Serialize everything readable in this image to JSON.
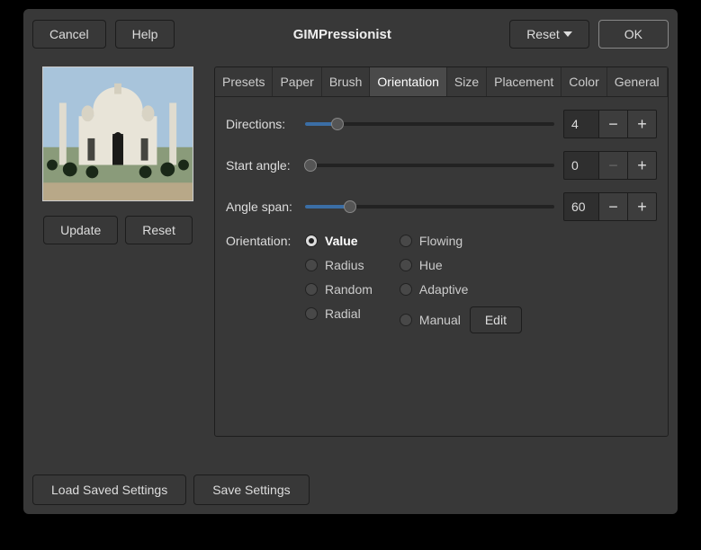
{
  "titlebar": {
    "cancel": "Cancel",
    "help": "Help",
    "title": "GIMPressionist",
    "reset": "Reset",
    "ok": "OK"
  },
  "preview": {
    "update": "Update",
    "reset": "Reset"
  },
  "tabs": [
    "Presets",
    "Paper",
    "Brush",
    "Orientation",
    "Size",
    "Placement",
    "Color",
    "General"
  ],
  "active_tab": "Orientation",
  "controls": {
    "directions_label": "Directions:",
    "directions_value": "4",
    "directions_fill_pct": 13,
    "start_angle_label": "Start angle:",
    "start_angle_value": "0",
    "start_angle_fill_pct": 2,
    "angle_span_label": "Angle span:",
    "angle_span_value": "60",
    "angle_span_fill_pct": 18,
    "orientation_label": "Orientation:"
  },
  "radios": {
    "col1": [
      "Value",
      "Radius",
      "Random",
      "Radial"
    ],
    "col2": [
      "Flowing",
      "Hue",
      "Adaptive",
      "Manual"
    ],
    "selected": "Value",
    "edit": "Edit"
  },
  "bottom": {
    "load": "Load Saved Settings",
    "save": "Save Settings"
  }
}
